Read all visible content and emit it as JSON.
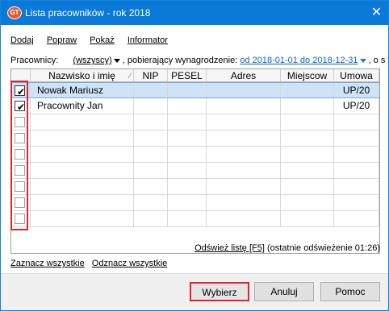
{
  "window": {
    "title": "Lista pracowników - rok 2018",
    "app_icon": "GT",
    "close_glyph": "✕"
  },
  "menu": [
    "Dodaj",
    "Popraw",
    "Pokaż",
    "Informator"
  ],
  "filters": {
    "employees_label": "Pracownicy:",
    "employees_value": "(wszyscy)",
    "mid_text": ", pobierający wynagrodzenie:",
    "period_value": "od 2018-01-01 do 2018-12-31",
    "tail_text": ", o s"
  },
  "table": {
    "columns": [
      "",
      "Nazwisko i imię",
      "NIP",
      "PESEL",
      "Adres",
      "Miejscow",
      "Umowa"
    ],
    "sort_mark": "⁄",
    "rows": [
      {
        "checked": true,
        "name": "Nowak Mariusz",
        "nip": "",
        "pesel": "",
        "adres": "",
        "miejscow": "",
        "umowa": "UP/20"
      },
      {
        "checked": true,
        "name": "Pracownity Jan",
        "nip": "",
        "pesel": "",
        "adres": "",
        "miejscow": "",
        "umowa": "UP/20"
      },
      {
        "checked": false,
        "name": "",
        "nip": "",
        "pesel": "",
        "adres": "",
        "miejscow": "",
        "umowa": ""
      },
      {
        "checked": false,
        "name": "",
        "nip": "",
        "pesel": "",
        "adres": "",
        "miejscow": "",
        "umowa": ""
      },
      {
        "checked": false,
        "name": "",
        "nip": "",
        "pesel": "",
        "adres": "",
        "miejscow": "",
        "umowa": ""
      },
      {
        "checked": false,
        "name": "",
        "nip": "",
        "pesel": "",
        "adres": "",
        "miejscow": "",
        "umowa": ""
      },
      {
        "checked": false,
        "name": "",
        "nip": "",
        "pesel": "",
        "adres": "",
        "miejscow": "",
        "umowa": ""
      },
      {
        "checked": false,
        "name": "",
        "nip": "",
        "pesel": "",
        "adres": "",
        "miejscow": "",
        "umowa": ""
      },
      {
        "checked": false,
        "name": "",
        "nip": "",
        "pesel": "",
        "adres": "",
        "miejscow": "",
        "umowa": ""
      }
    ]
  },
  "refresh": {
    "link": "Odśwież listę [F5]",
    "note": "(ostatnie odświeżenie 01:26)"
  },
  "select_links": {
    "select_all": "Zaznacz wszystkie",
    "deselect_all": "Odznacz wszystkie"
  },
  "buttons": {
    "choose": "Wybierz",
    "cancel": "Anuluj",
    "help": "Pomoc"
  },
  "colors": {
    "titlebar": "#0a79d7",
    "highlight": "#e0242a",
    "selected_row": "#cfe3f7",
    "link": "#0d63c9"
  }
}
